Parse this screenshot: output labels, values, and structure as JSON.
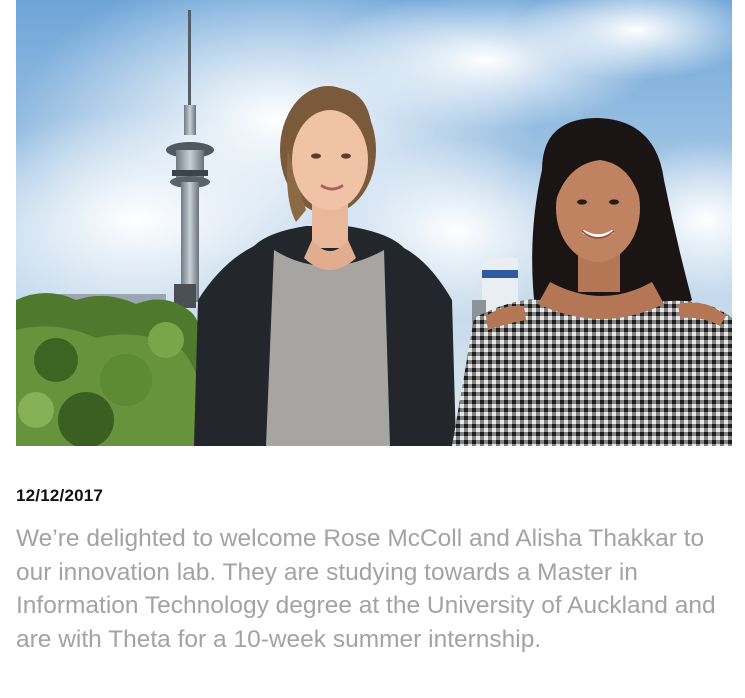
{
  "article": {
    "photo_icon": "photo-icon",
    "date": "12/12/2017",
    "body": "We’re delighted to welcome Rose McColl and Alisha Thakkar to our innovation lab. They are studying towards a Master in Information Technology degree at the University of Auckland and are with Theta for a 10-week summer internship."
  },
  "colors": {
    "date_text": "#111111",
    "body_text": "#a3a3a3",
    "sky": "#7fb0dc",
    "foliage": "#4f7a2e"
  }
}
